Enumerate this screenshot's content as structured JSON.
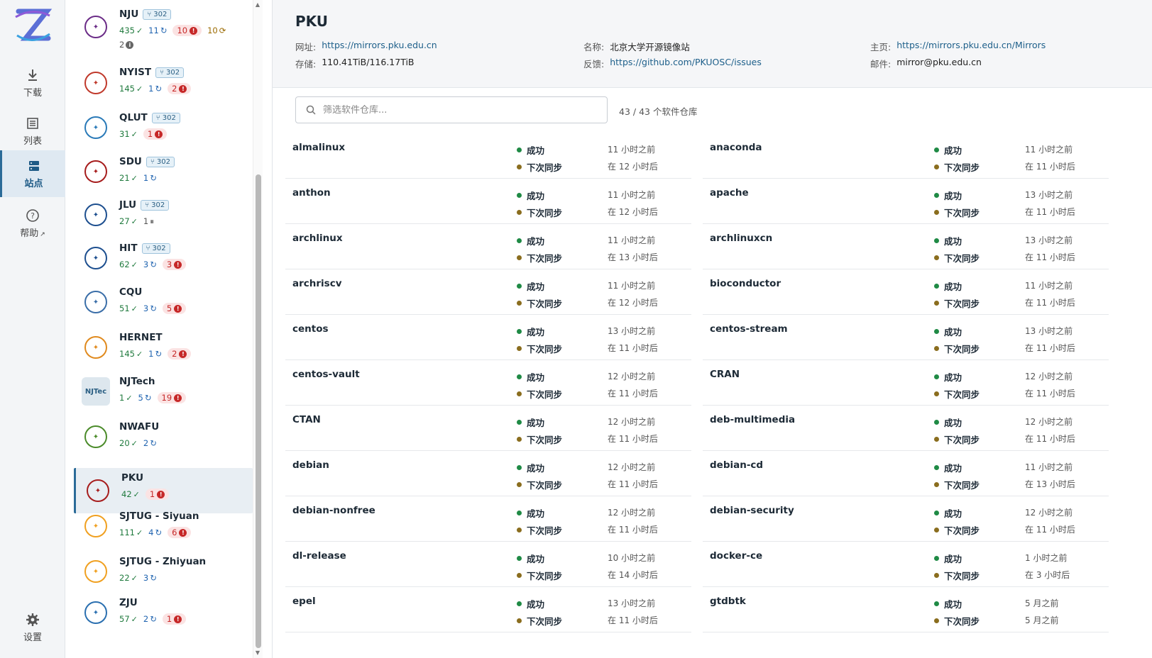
{
  "nav": {
    "items": [
      {
        "label": "下载",
        "icon": "download-icon"
      },
      {
        "label": "列表",
        "icon": "list-icon"
      },
      {
        "label": "站点",
        "icon": "server-icon"
      },
      {
        "label": "帮助",
        "icon": "help-icon",
        "external": "↗"
      }
    ],
    "settings_label": "设置"
  },
  "sites": [
    {
      "name": "NJU",
      "tag": "302",
      "ok": "435",
      "sync": "11",
      "fail": "10",
      "cache": "10",
      "unknown": "2",
      "color": "#6b2c87"
    },
    {
      "name": "NYIST",
      "tag": "302",
      "ok": "145",
      "sync": "1",
      "fail": "2",
      "color": "#c0392b"
    },
    {
      "name": "QLUT",
      "tag": "302",
      "ok": "31",
      "fail": "1",
      "color": "#2a7ab8"
    },
    {
      "name": "SDU",
      "tag": "302",
      "ok": "21",
      "sync": "1",
      "color": "#a61c1c"
    },
    {
      "name": "JLU",
      "tag": "302",
      "ok": "27",
      "pause": "1",
      "color": "#1d4f8f"
    },
    {
      "name": "HIT",
      "tag": "302",
      "ok": "62",
      "sync": "3",
      "fail": "3",
      "color": "#1d4f8f"
    },
    {
      "name": "CQU",
      "ok": "51",
      "sync": "3",
      "fail": "5",
      "color": "#3a6ea8"
    },
    {
      "name": "HERNET",
      "ok": "145",
      "sync": "1",
      "fail": "2",
      "color": "#e08a1e"
    },
    {
      "name": "NJTech",
      "ok": "1",
      "sync": "5",
      "fail": "19",
      "logo_text": "NJTec",
      "color": "#2b5f83"
    },
    {
      "name": "NWAFU",
      "ok": "20",
      "sync": "2",
      "color": "#4b8b2a"
    },
    {
      "name": "PKU",
      "ok": "42",
      "fail": "1",
      "color": "#a61c1c",
      "selected": true
    },
    {
      "name": "SJTUG - Siyuan",
      "ok": "111",
      "sync": "4",
      "fail": "6",
      "color": "#f0a020"
    },
    {
      "name": "SJTUG - Zhiyuan",
      "ok": "22",
      "sync": "3",
      "color": "#f0a020"
    },
    {
      "name": "ZJU",
      "ok": "57",
      "sync": "2",
      "fail": "1",
      "color": "#2a6fb0"
    }
  ],
  "header": {
    "title": "PKU",
    "url_label": "网址:",
    "url": "https://mirrors.pku.edu.cn",
    "storage_label": "存储:",
    "storage": "110.41TiB/116.17TiB",
    "name_label": "名称:",
    "name": "北京大学开源镜像站",
    "feedback_label": "反馈:",
    "feedback": "https://github.com/PKUOSC/issues",
    "home_label": "主页:",
    "home": "https://mirrors.pku.edu.cn/Mirrors",
    "email_label": "邮件:",
    "email": "mirror@pku.edu.cn"
  },
  "filter": {
    "placeholder": "筛选软件仓库...",
    "count": "43 / 43 个软件仓库"
  },
  "status_ok": "成功",
  "status_next": "下次同步",
  "repos": [
    {
      "name": "almalinux",
      "last": "11 小时之前",
      "next": "在 12 小时后"
    },
    {
      "name": "anaconda",
      "last": "11 小时之前",
      "next": "在 11 小时后"
    },
    {
      "name": "anthon",
      "last": "11 小时之前",
      "next": "在 12 小时后"
    },
    {
      "name": "apache",
      "last": "13 小时之前",
      "next": "在 11 小时后"
    },
    {
      "name": "archlinux",
      "last": "11 小时之前",
      "next": "在 13 小时后"
    },
    {
      "name": "archlinuxcn",
      "last": "13 小时之前",
      "next": "在 11 小时后"
    },
    {
      "name": "archriscv",
      "last": "11 小时之前",
      "next": "在 12 小时后"
    },
    {
      "name": "bioconductor",
      "last": "11 小时之前",
      "next": "在 11 小时后"
    },
    {
      "name": "centos",
      "last": "13 小时之前",
      "next": "在 11 小时后"
    },
    {
      "name": "centos-stream",
      "last": "13 小时之前",
      "next": "在 11 小时后"
    },
    {
      "name": "centos-vault",
      "last": "12 小时之前",
      "next": "在 11 小时后"
    },
    {
      "name": "CRAN",
      "last": "12 小时之前",
      "next": "在 11 小时后"
    },
    {
      "name": "CTAN",
      "last": "12 小时之前",
      "next": "在 11 小时后"
    },
    {
      "name": "deb-multimedia",
      "last": "12 小时之前",
      "next": "在 11 小时后"
    },
    {
      "name": "debian",
      "last": "12 小时之前",
      "next": "在 11 小时后"
    },
    {
      "name": "debian-cd",
      "last": "11 小时之前",
      "next": "在 13 小时后"
    },
    {
      "name": "debian-nonfree",
      "last": "12 小时之前",
      "next": "在 11 小时后"
    },
    {
      "name": "debian-security",
      "last": "12 小时之前",
      "next": "在 11 小时后"
    },
    {
      "name": "dl-release",
      "last": "10 小时之前",
      "next": "在 14 小时后"
    },
    {
      "name": "docker-ce",
      "last": "1 小时之前",
      "next": "在 3 小时后"
    },
    {
      "name": "epel",
      "last": "13 小时之前",
      "next": "在 11 小时后"
    },
    {
      "name": "gtdbtk",
      "last": "5 月之前",
      "next": "5 月之前"
    }
  ]
}
